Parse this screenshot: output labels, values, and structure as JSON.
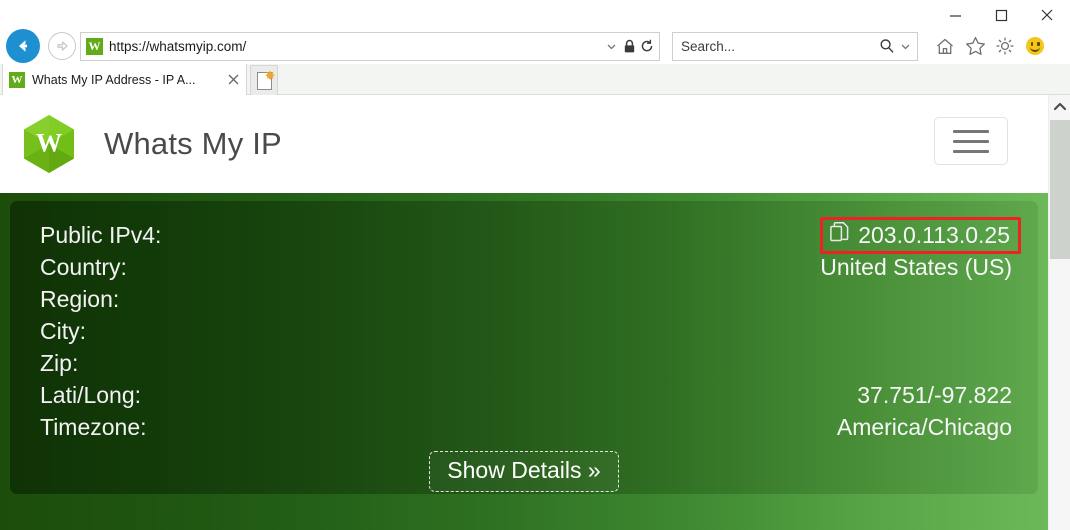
{
  "window": {
    "minimize_label": "Minimize",
    "maximize_label": "Maximize",
    "close_label": "Close"
  },
  "browser": {
    "back_label": "Back",
    "forward_label": "Forward",
    "address": {
      "favicon_letter": "W",
      "url": "https://whatsmyip.com/",
      "dropdown_icon": "chevron-down-icon",
      "lock_icon": "padlock-icon",
      "refresh_icon": "refresh-icon"
    },
    "search": {
      "placeholder": "Search...",
      "search_icon": "magnifier-icon",
      "dropdown_icon": "chevron-down-icon"
    },
    "tools": [
      {
        "name": "home-icon",
        "label": "Home"
      },
      {
        "name": "favorites-star-icon",
        "label": "Favorites"
      },
      {
        "name": "gear-icon",
        "label": "Tools"
      },
      {
        "name": "smiley-icon",
        "label": "Send a Smile"
      }
    ],
    "tabs": [
      {
        "favicon_letter": "W",
        "title": "Whats My IP Address - IP A...",
        "close_label": "Close tab"
      }
    ],
    "new_tab_label": "New tab"
  },
  "site": {
    "logo_letter": "W",
    "logo_color": "#7ac51e",
    "title": "Whats My IP",
    "menu_label": "Menu"
  },
  "hero": {
    "accent_green": "#6cb95a",
    "highlight_color": "#ee2222",
    "rows": [
      {
        "label": "Public IPv4:",
        "value": "203.0.113.0.25",
        "icon": "copy-icon",
        "highlighted": true
      },
      {
        "label": "Country:",
        "value": "United States (US)",
        "highlighted": false
      },
      {
        "label": "Region:",
        "value": "",
        "highlighted": false
      },
      {
        "label": "City:",
        "value": "",
        "highlighted": false
      },
      {
        "label": "Zip:",
        "value": "",
        "highlighted": false
      },
      {
        "label": "Lati/Long:",
        "value": "37.751/-97.822",
        "highlighted": false
      },
      {
        "label": "Timezone:",
        "value": "America/Chicago",
        "highlighted": false
      }
    ],
    "details_button": "Show Details »"
  },
  "scrollbar": {
    "up_arrow_icon": "chevron-up-icon"
  }
}
